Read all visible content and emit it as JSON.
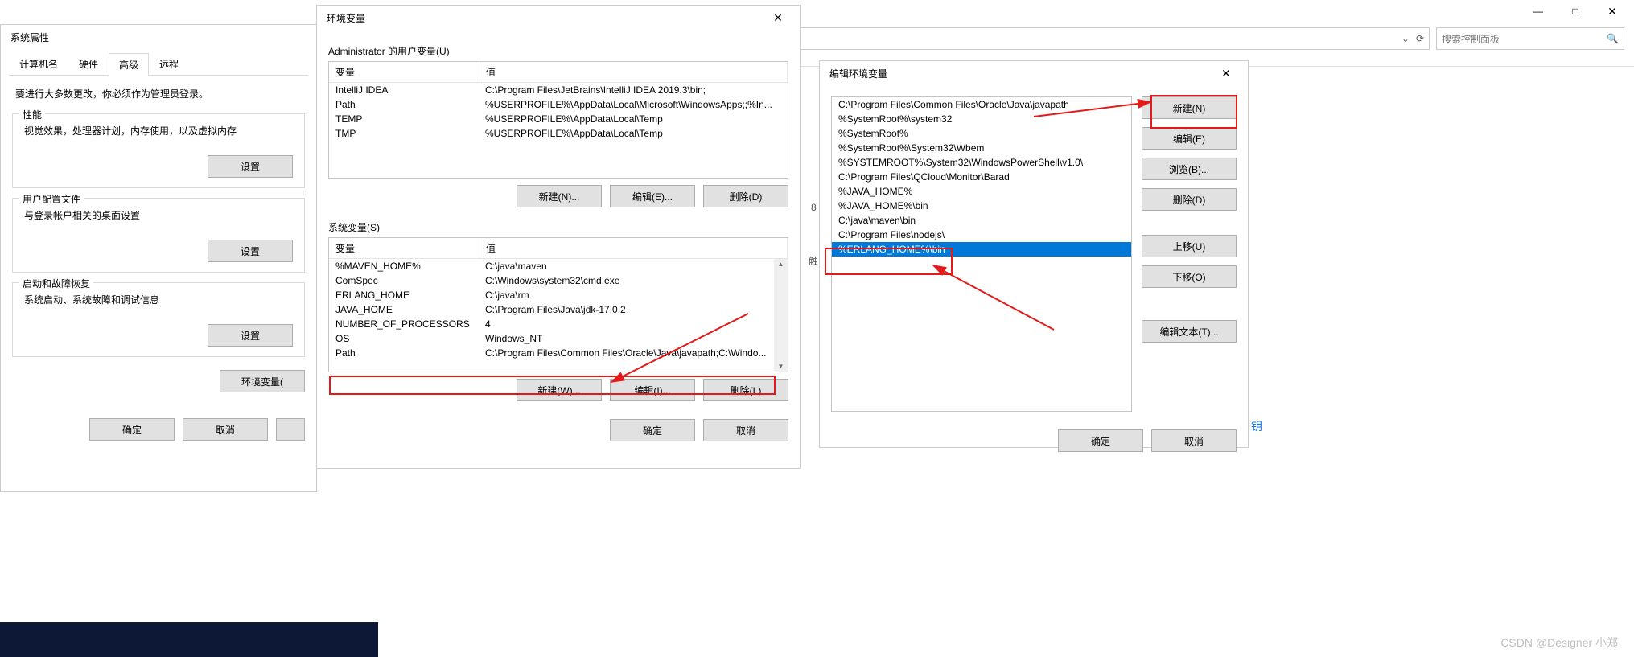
{
  "bgWindow": {
    "refreshIcon": "⟳",
    "searchPlaceholder": "搜索控制面板",
    "minimize": "—",
    "maximize": "□",
    "close": "✕"
  },
  "sysProps": {
    "title": "系统属性",
    "tabs": [
      "计算机名",
      "硬件",
      "高级",
      "远程"
    ],
    "adminNote": "要进行大多数更改，你必须作为管理员登录。",
    "perf": {
      "legend": "性能",
      "text": "视觉效果，处理器计划，内存使用，以及虚拟内存",
      "btn": "设置"
    },
    "userProf": {
      "legend": "用户配置文件",
      "text": "与登录帐户相关的桌面设置",
      "btn": "设置"
    },
    "startup": {
      "legend": "启动和故障恢复",
      "text": "系统启动、系统故障和调试信息",
      "btn": "设置"
    },
    "envBtn": "环境变量(",
    "ok": "确定",
    "cancel": "取消"
  },
  "envDlg": {
    "title": "环境变量",
    "close": "✕",
    "userLabel": "Administrator 的用户变量(U)",
    "headVar": "变量",
    "headVal": "值",
    "userVars": [
      {
        "k": "IntelliJ IDEA",
        "v": "C:\\Program Files\\JetBrains\\IntelliJ IDEA 2019.3\\bin;"
      },
      {
        "k": "Path",
        "v": "%USERPROFILE%\\AppData\\Local\\Microsoft\\WindowsApps;;%In..."
      },
      {
        "k": "TEMP",
        "v": "%USERPROFILE%\\AppData\\Local\\Temp"
      },
      {
        "k": "TMP",
        "v": "%USERPROFILE%\\AppData\\Local\\Temp"
      }
    ],
    "newU": "新建(N)...",
    "editU": "编辑(E)...",
    "delU": "删除(D)",
    "sysLabel": "系统变量(S)",
    "sysVars": [
      {
        "k": "%MAVEN_HOME%",
        "v": "C:\\java\\maven"
      },
      {
        "k": "ComSpec",
        "v": "C:\\Windows\\system32\\cmd.exe"
      },
      {
        "k": "ERLANG_HOME",
        "v": "C:\\java\\rm"
      },
      {
        "k": "JAVA_HOME",
        "v": "C:\\Program Files\\Java\\jdk-17.0.2"
      },
      {
        "k": "NUMBER_OF_PROCESSORS",
        "v": "4"
      },
      {
        "k": "OS",
        "v": "Windows_NT"
      },
      {
        "k": "Path",
        "v": "C:\\Program Files\\Common Files\\Oracle\\Java\\javapath;C:\\Windo..."
      }
    ],
    "newS": "新建(W)...",
    "editS": "编辑(I)...",
    "delS": "删除(L)",
    "ok": "确定",
    "cancel": "取消"
  },
  "editPath": {
    "title": "编辑环境变量",
    "close": "✕",
    "items": [
      "C:\\Program Files\\Common Files\\Oracle\\Java\\javapath",
      "%SystemRoot%\\system32",
      "%SystemRoot%",
      "%SystemRoot%\\System32\\Wbem",
      "%SYSTEMROOT%\\System32\\WindowsPowerShell\\v1.0\\",
      "C:\\Program Files\\QCloud\\Monitor\\Barad",
      "%JAVA_HOME%",
      "%JAVA_HOME%\\bin",
      "C:\\java\\maven\\bin",
      "C:\\Program Files\\nodejs\\",
      "%ERLANG_HOME%\\bin"
    ],
    "selectedIndex": 10,
    "btnNew": "新建(N)",
    "btnEdit": "编辑(E)",
    "btnBrowse": "浏览(B)...",
    "btnDel": "删除(D)",
    "btnUp": "上移(U)",
    "btnDown": "下移(O)",
    "btnEditText": "编辑文本(T)...",
    "ok": "确定",
    "cancel": "取消"
  },
  "sideText": "钥",
  "stray": {
    "a": "8",
    "b": "触"
  },
  "watermark": "CSDN @Designer 小郑"
}
